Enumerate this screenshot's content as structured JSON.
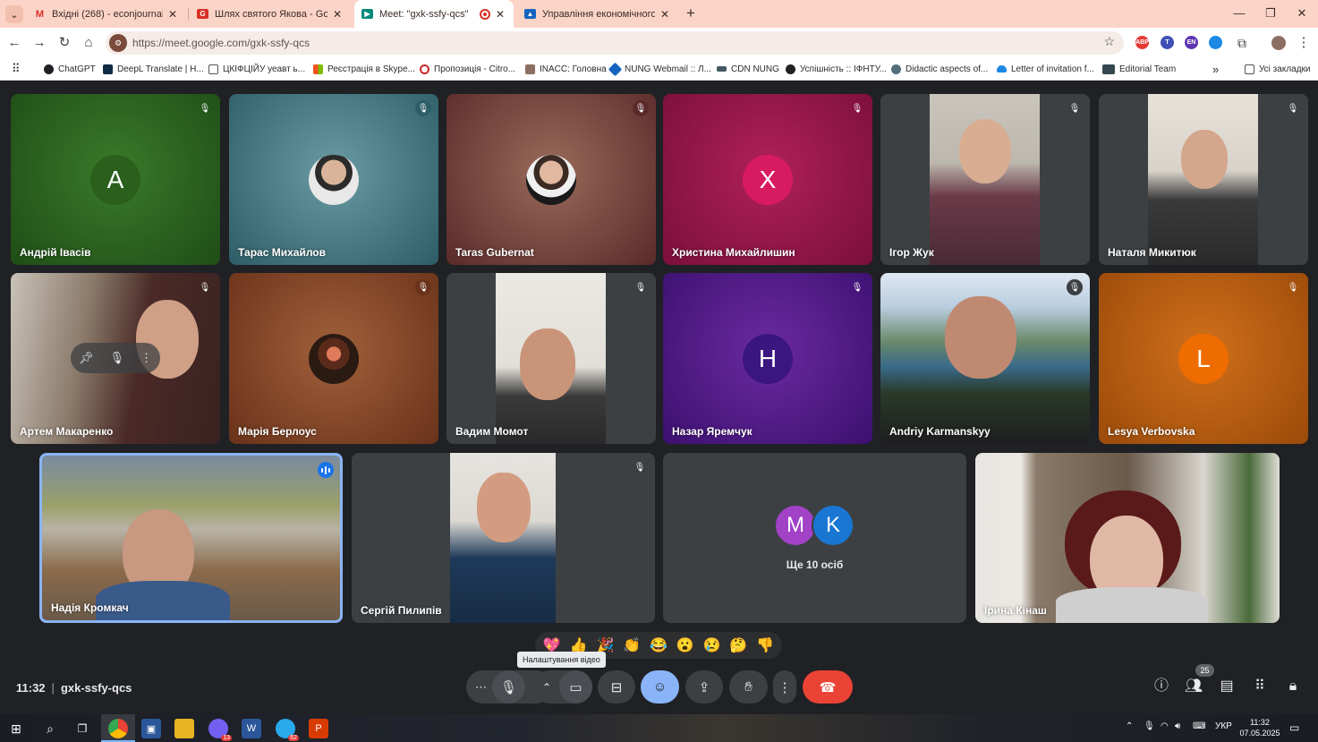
{
  "browser": {
    "tabs": [
      {
        "title": "Вхідні (268) - econjournal@nun",
        "favicon": "gmail-icon",
        "color": "#d93025",
        "active": false
      },
      {
        "title": "Шлях святого Якова - Gorgany",
        "favicon": "gorgany-icon",
        "color": "#d93025",
        "active": false
      },
      {
        "title": "Meet: \"gxk-ssfy-qcs\"",
        "favicon": "meet-icon",
        "color": "#00897b",
        "active": true
      },
      {
        "title": "Управління економічного роз",
        "favicon": "gov-icon",
        "color": "#1565c0",
        "active": false
      }
    ],
    "url": "https://meet.google.com/gxk-ssfy-qcs",
    "extensions": [
      {
        "label": "ABP",
        "color": "#e53935"
      },
      {
        "label": "T",
        "color": "#3f51b5"
      },
      {
        "label": "EN",
        "color": "#5e35b1"
      },
      {
        "label": "",
        "color": "#1e88e5"
      }
    ],
    "bookmarks": [
      {
        "label": "ChatGPT",
        "color": "#202124"
      },
      {
        "label": "DeepL Translate | H...",
        "color": "#0f2b46"
      },
      {
        "label": "ЦКІФЦІЙУ уеавт ь...",
        "color": "#ffffff"
      },
      {
        "label": "Реєстрація в Skype...",
        "color": "#f25022"
      },
      {
        "label": "Пропозиція - Citro...",
        "color": "#c62828"
      },
      {
        "label": "INACC: Головна",
        "color": "#8d6e63"
      },
      {
        "label": "NUNG Webmail :: Л...",
        "color": "#1565c0"
      },
      {
        "label": "CDN NUNG",
        "color": "#455a64"
      },
      {
        "label": "Успішність :: ІФНТУ...",
        "color": "#212121"
      },
      {
        "label": "Didactic aspects of...",
        "color": "#546e7a"
      },
      {
        "label": "Letter of invitation f...",
        "color": "#1e88e5"
      },
      {
        "label": "Editorial Team",
        "color": "#37474f"
      }
    ],
    "all_bookmarks": "Усі закладки"
  },
  "meet": {
    "participants": [
      {
        "name": "Андрій Івасів",
        "avatar": "A",
        "bg": "#2e6b1e",
        "avatar_color": "#2a5f1c",
        "kind": "letter"
      },
      {
        "name": "Тарас Михайлов",
        "bg": "#4e7f8a",
        "kind": "photo"
      },
      {
        "name": "Taras Gubernat",
        "bg": "#7a3a3a",
        "kind": "photo"
      },
      {
        "name": "Христина Михайлишин",
        "avatar": "X",
        "bg": "#8a1646",
        "avatar_color": "#d81b60",
        "kind": "letter"
      },
      {
        "name": "Ігор Жук",
        "bg": "#3c4043",
        "kind": "video"
      },
      {
        "name": "Наталя Микитюк",
        "bg": "#3c4043",
        "kind": "video"
      },
      {
        "name": "Артем Макаренко",
        "bg": "#6b4a3a",
        "kind": "video"
      },
      {
        "name": "Марія Берлоус",
        "bg": "#7a3f22",
        "kind": "photo"
      },
      {
        "name": "Вадим Момот",
        "bg": "#3c4043",
        "kind": "video"
      },
      {
        "name": "Назар Яремчук",
        "avatar": "H",
        "bg": "#4a148c",
        "avatar_color": "#3b1580",
        "kind": "letter"
      },
      {
        "name": "Andriy Karmanskyy",
        "bg": "#5a7a9a",
        "kind": "video"
      },
      {
        "name": "Lesya Verbovska",
        "avatar": "L",
        "bg": "#b85a12",
        "avatar_color": "#ef6c00",
        "kind": "letter"
      },
      {
        "name": "Надія Кромкач",
        "bg": "#8a8576",
        "kind": "video",
        "speaking": true
      },
      {
        "name": "Сергій Пилипів",
        "bg": "#3c4043",
        "kind": "video"
      },
      {
        "name": "Ірина Кінаш",
        "bg": "#d9d6cf",
        "kind": "video"
      }
    ],
    "more": {
      "avatars": [
        {
          "letter": "M",
          "color": "#a142c7"
        },
        {
          "letter": "K",
          "color": "#1976d2"
        }
      ],
      "label": "Ще 10 осіб"
    },
    "reactions": [
      "💖",
      "👍",
      "🎉",
      "👏",
      "😂",
      "😮",
      "😢",
      "🤔",
      "👎"
    ],
    "tooltip": "Налаштування відео",
    "time": "11:32",
    "code": "gxk-ssfy-qcs",
    "people_count": "25"
  },
  "taskbar": {
    "lang": "УКР",
    "time": "11:32",
    "date": "07.05.2025",
    "telegram_badge": "62",
    "viber_badge": "13"
  }
}
